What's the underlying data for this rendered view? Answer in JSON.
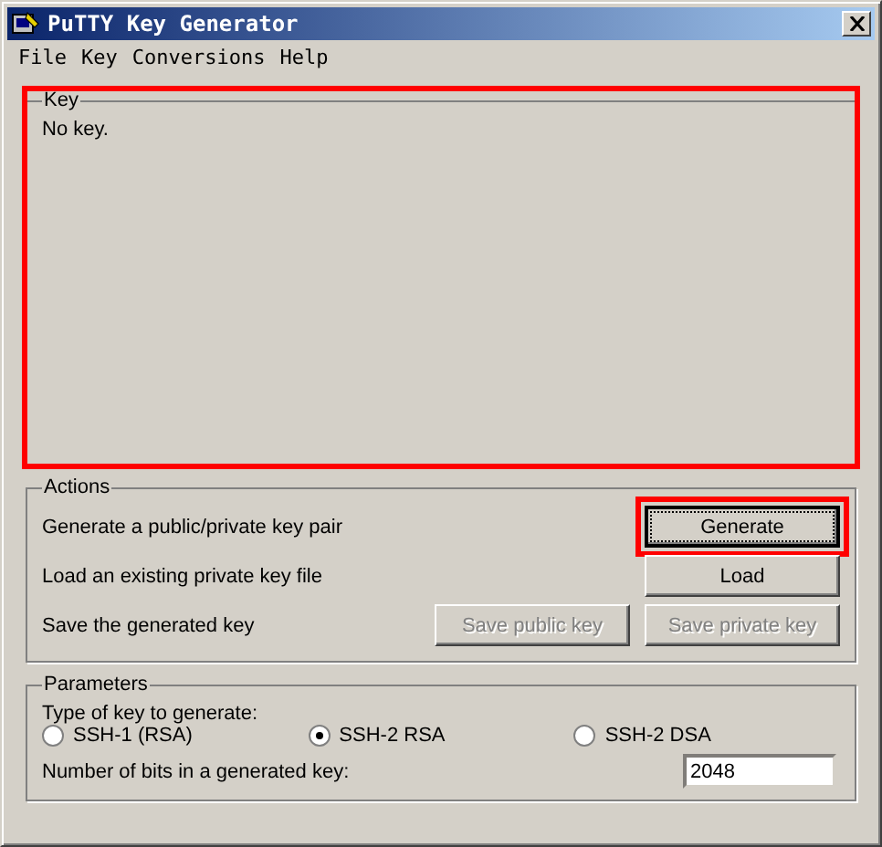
{
  "window": {
    "title": "PuTTY Key Generator"
  },
  "menu": [
    "File",
    "Key",
    "Conversions",
    "Help"
  ],
  "key_group": {
    "title": "Key",
    "text": "No key.",
    "highlighted": true
  },
  "actions": {
    "title": "Actions",
    "rows": [
      {
        "label": "Generate a public/private key pair",
        "buttons": [
          {
            "label": "Generate",
            "disabled": false,
            "focused": true,
            "highlighted": true
          }
        ]
      },
      {
        "label": "Load an existing private key file",
        "buttons": [
          {
            "label": "Load",
            "disabled": false,
            "focused": false,
            "highlighted": false
          }
        ]
      },
      {
        "label": "Save the generated key",
        "buttons": [
          {
            "label": "Save public key",
            "disabled": true,
            "focused": false,
            "highlighted": false
          },
          {
            "label": "Save private key",
            "disabled": true,
            "focused": false,
            "highlighted": false
          }
        ]
      }
    ]
  },
  "parameters": {
    "title": "Parameters",
    "type_label": "Type of key to generate:",
    "key_types": [
      {
        "label": "SSH-1 (RSA)",
        "selected": false
      },
      {
        "label": "SSH-2 RSA",
        "selected": true
      },
      {
        "label": "SSH-2 DSA",
        "selected": false
      }
    ],
    "bits_label": "Number of bits in a generated key:",
    "bits_value": "2048"
  }
}
